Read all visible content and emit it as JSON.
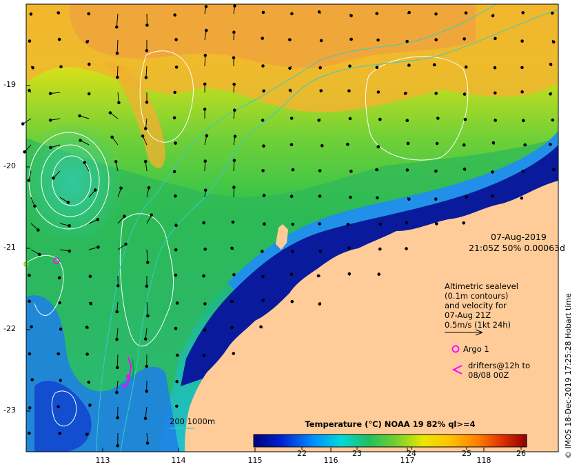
{
  "map": {
    "x_ticks": [
      "113",
      "114",
      "115",
      "116",
      "117",
      "118"
    ],
    "y_ticks": [
      "-19",
      "-20",
      "-21",
      "-22",
      "-23"
    ]
  },
  "info": {
    "date": "07-Aug-2019",
    "time_line": "21:05Z  50% 0.00063d"
  },
  "legend": {
    "alt_line1": "Altimetric sealevel",
    "alt_line2": "(0.1m contours)",
    "alt_line3": "and velocity for",
    "alt_line4": "07-Aug 21Z",
    "scale_label": "0.5m/s (1kt 24h)",
    "argo_label": "Argo 1",
    "drifter_line1": "drifters@12h to",
    "drifter_line2": "08/08 00Z",
    "isobath_label": "200  1000m"
  },
  "colorbar": {
    "title": "Temperature (°C) NOAA 19 82% ql>=4",
    "ticks": [
      "22",
      "23",
      "24",
      "25",
      "26"
    ]
  },
  "credit": "© IMOS 18-Dec-2019 17:25:28 Hobart time",
  "colors": {
    "land": "#ffcc99",
    "argo": "#ff00ff",
    "drifter": "#ff00ff",
    "isobath": "#33cccc",
    "contour": "#ffffff"
  }
}
